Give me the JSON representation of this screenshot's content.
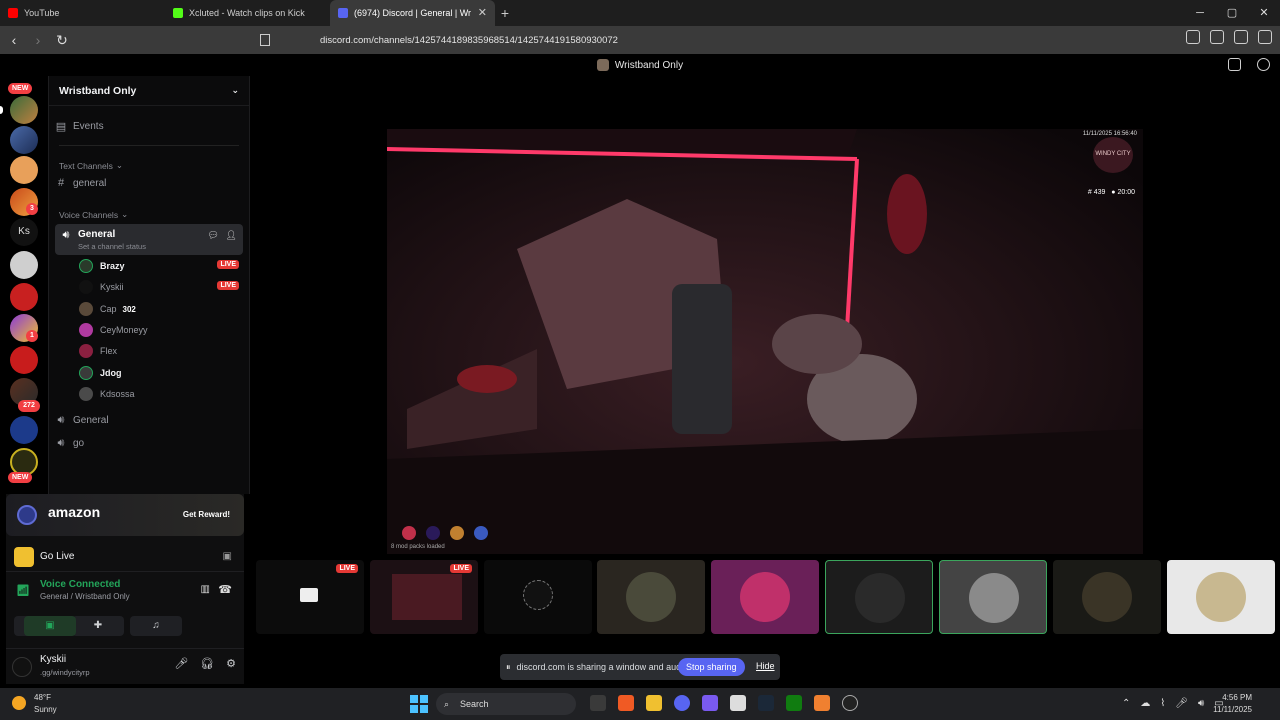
{
  "browser": {
    "tabs": [
      {
        "title": "YouTube",
        "color": "#ff0000",
        "active": false
      },
      {
        "title": "Xcluted - Watch clips on Kick",
        "color": "#53fc18",
        "active": false
      },
      {
        "title": "(6974) Discord | General | Wr",
        "color": "#5865f2",
        "active": true
      }
    ],
    "url": "discord.com/channels/1425744189835968514/1425744191580930072"
  },
  "discord": {
    "window_title": "Wristband Only",
    "guild_badges": [
      "NEW",
      "3",
      "Ks",
      "1",
      "272",
      "NEW"
    ],
    "server_name": "Wristband Only",
    "events_label": "Events",
    "text_channels_label": "Text Channels",
    "text_channel": "general",
    "voice_channels_label": "Voice Channels",
    "voice_channel": "General",
    "channel_status": "Set a channel status",
    "voice_users": [
      {
        "name": "Brazy",
        "live": "LIVE",
        "bold": true
      },
      {
        "name": "Kyskii",
        "live": "LIVE",
        "bold": false
      },
      {
        "name": "Cap",
        "extra": "302",
        "bold": false
      },
      {
        "name": "CeyMoneyy",
        "bold": false
      },
      {
        "name": "Flex",
        "bold": false
      },
      {
        "name": "Jdog",
        "bold": true
      },
      {
        "name": "Kdsossa",
        "bold": false
      }
    ],
    "voice_channel_2": "General",
    "voice_channel_3": "go",
    "promo": {
      "brand": "amazon",
      "cta": "Get Reward!"
    },
    "go_live": "Go Live",
    "voice_status": "Voice Connected",
    "voice_location": "General / Wristband Only",
    "me": {
      "name": "Kyskii",
      "status": ".gg/windycityrp"
    },
    "video_hud": {
      "timestamp": "11/11/2025 16:56:40",
      "server_logo": "WINDY CITY",
      "id": "# 439",
      "time": "20:00",
      "mods": "8 mod packs loaded"
    },
    "tiles": [
      {
        "live": "LIVE"
      },
      {
        "live": "LIVE"
      },
      {},
      {},
      {},
      {},
      {},
      {},
      {}
    ],
    "share_bar": {
      "message": "discord.com is sharing a window and audio.",
      "stop": "Stop sharing",
      "hide": "Hide"
    }
  },
  "taskbar": {
    "temp": "48°F",
    "weather": "Sunny",
    "search": "Search",
    "time": "4:56 PM",
    "date": "11/11/2025"
  }
}
